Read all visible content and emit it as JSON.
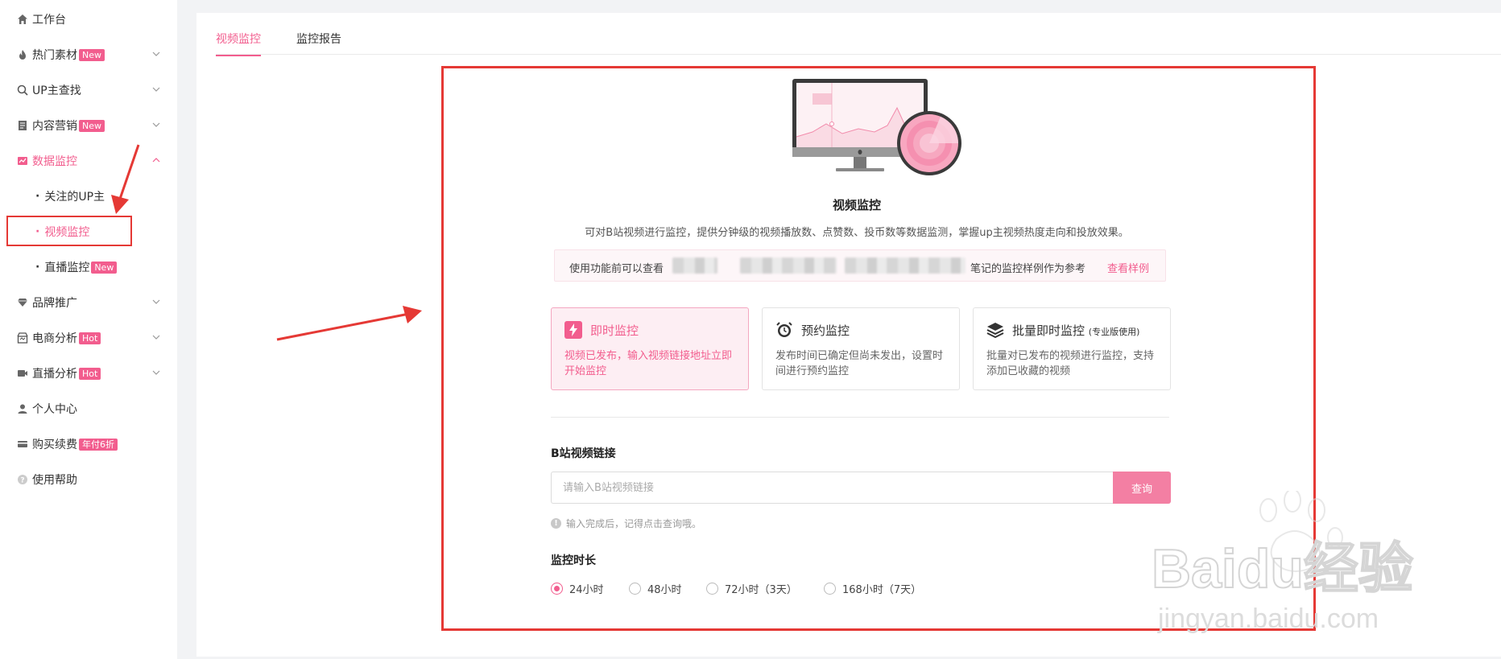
{
  "sidebar": {
    "items": [
      {
        "label": "工作台",
        "icon": "home-icon"
      },
      {
        "label": "热门素材",
        "badge": "New",
        "icon": "fire-icon"
      },
      {
        "label": "UP主查找",
        "icon": "search-icon"
      },
      {
        "label": "内容营销",
        "badge": "New",
        "icon": "document-icon"
      },
      {
        "label": "数据监控",
        "icon": "line-chart-icon",
        "active": true
      },
      {
        "label": "品牌推广",
        "icon": "diamond-icon"
      },
      {
        "label": "电商分析",
        "badge": "Hot",
        "icon": "shop-icon"
      },
      {
        "label": "直播分析",
        "badge": "Hot",
        "icon": "video-camera-icon"
      },
      {
        "label": "个人中心",
        "icon": "user-icon"
      },
      {
        "label": "购买续费",
        "badge": "年付6折",
        "icon": "card-icon"
      },
      {
        "label": "使用帮助",
        "icon": "help-icon"
      }
    ],
    "sub_items": [
      {
        "label": "关注的UP主"
      },
      {
        "label": "视频监控",
        "active": true
      },
      {
        "label": "直播监控",
        "badge": "New"
      }
    ]
  },
  "tabs": [
    {
      "label": "视频监控",
      "active": true
    },
    {
      "label": "监控报告"
    }
  ],
  "main": {
    "title": "视频监控",
    "description": "可对B站视频进行监控，提供分钟级的视频播放数、点赞数、投币数等数据监测，掌握up主视频热度走向和投放效果。",
    "tip_prefix": "使用功能前可以查看",
    "tip_suffix": "笔记的监控样例作为参考",
    "tip_link": "查看样例",
    "modes": [
      {
        "title": "即时监控",
        "desc": "视频已发布，输入视频链接地址立即开始监控",
        "icon": "lightning-icon",
        "active": true
      },
      {
        "title": "预约监控",
        "desc": "发布时间已确定但尚未发出，设置时间进行预约监控",
        "icon": "alarm-clock-icon"
      },
      {
        "title": "批量即时监控",
        "title_note": "(专业版使用)",
        "desc": "批量对已发布的视频进行监控，支持添加已收藏的视频",
        "icon": "layers-icon"
      }
    ],
    "link_label": "B站视频链接",
    "link_placeholder": "请输入B站视频链接",
    "query_button": "查询",
    "hint": "输入完成后，记得点击查询哦。",
    "duration_label": "监控时长",
    "durations": [
      "24小时",
      "48小时",
      "72小时（3天）",
      "168小时（7天）"
    ],
    "selected_duration": "24小时"
  },
  "watermark": {
    "brand": "Baidu经验",
    "url": "jingyan.baidu.com"
  },
  "colors": {
    "accent": "#f25d8e",
    "annotation": "#e53935"
  }
}
